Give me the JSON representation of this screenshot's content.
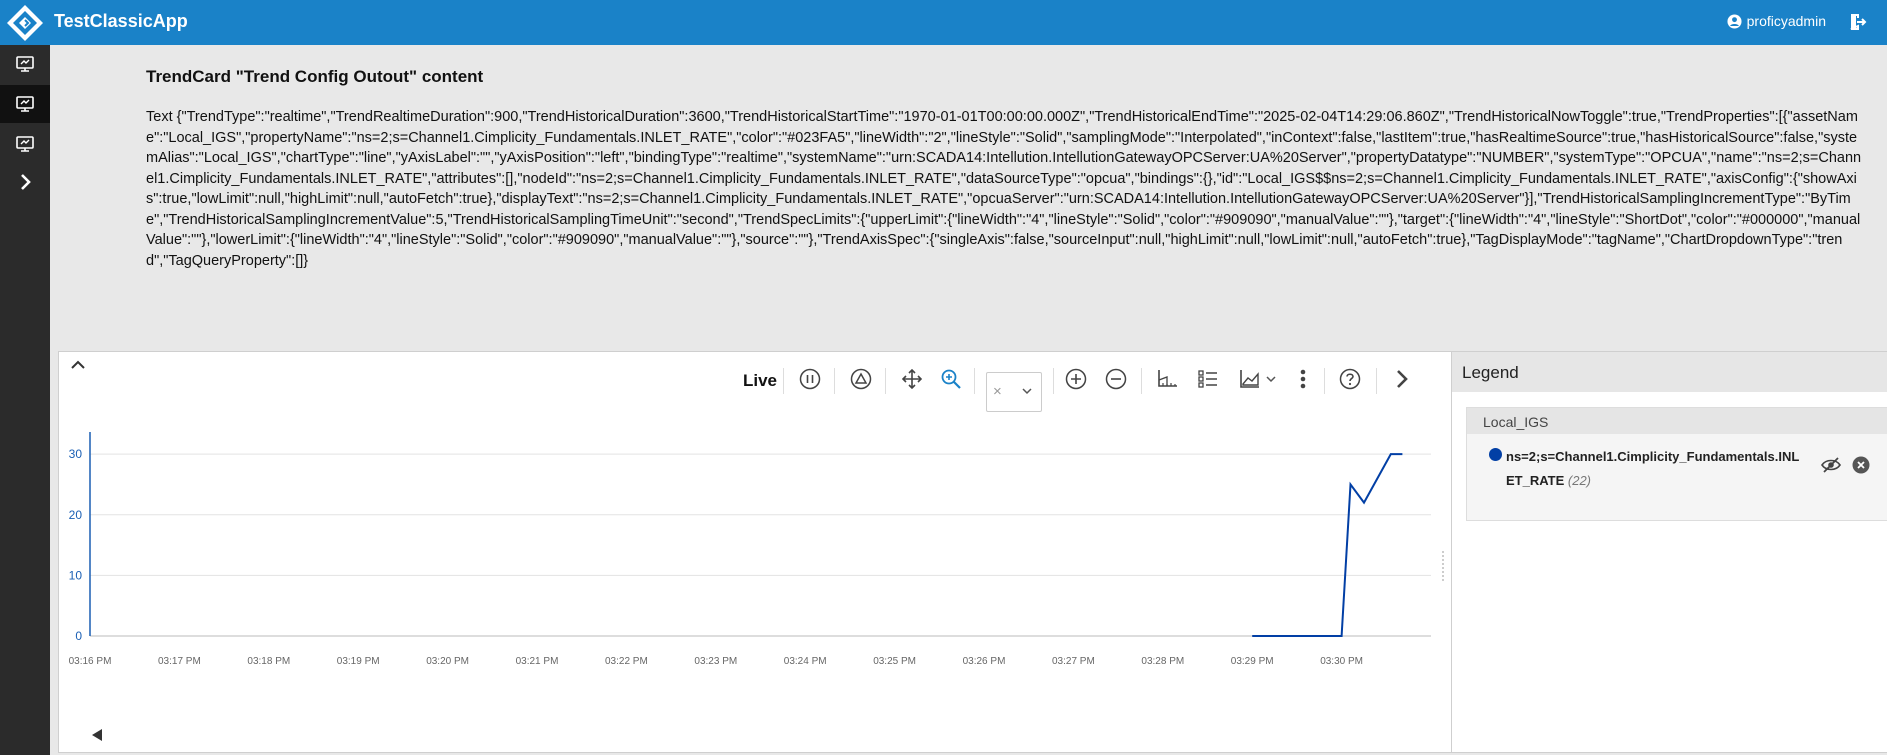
{
  "header": {
    "app_title": "TestClassicApp",
    "username": "proficyadmin"
  },
  "sidebar": {
    "items": [
      {
        "name": "display-1",
        "active": false
      },
      {
        "name": "display-2",
        "active": true
      },
      {
        "name": "display-3",
        "active": false
      },
      {
        "name": "expand",
        "active": false
      }
    ]
  },
  "card": {
    "title": "TrendCard \"Trend Config Outout\" content",
    "text": "Text {\"TrendType\":\"realtime\",\"TrendRealtimeDuration\":900,\"TrendHistoricalDuration\":3600,\"TrendHistoricalStartTime\":\"1970-01-01T00:00:00.000Z\",\"TrendHistoricalEndTime\":\"2025-02-04T14:29:06.860Z\",\"TrendHistoricalNowToggle\":true,\"TrendProperties\":[{\"assetName\":\"Local_IGS\",\"propertyName\":\"ns=2;s=Channel1.Cimplicity_Fundamentals.INLET_RATE\",\"color\":\"#023FA5\",\"lineWidth\":\"2\",\"lineStyle\":\"Solid\",\"samplingMode\":\"Interpolated\",\"inContext\":false,\"lastItem\":true,\"hasRealtimeSource\":true,\"hasHistoricalSource\":false,\"systemAlias\":\"Local_IGS\",\"chartType\":\"line\",\"yAxisLabel\":\"\",\"yAxisPosition\":\"left\",\"bindingType\":\"realtime\",\"systemName\":\"urn:SCADA14:Intellution.IntellutionGatewayOPCServer:UA%20Server\",\"propertyDatatype\":\"NUMBER\",\"systemType\":\"OPCUA\",\"name\":\"ns=2;s=Channel1.Cimplicity_Fundamentals.INLET_RATE\",\"attributes\":[],\"nodeId\":\"ns=2;s=Channel1.Cimplicity_Fundamentals.INLET_RATE\",\"dataSourceType\":\"opcua\",\"bindings\":{},\"id\":\"Local_IGS$$ns=2;s=Channel1.Cimplicity_Fundamentals.INLET_RATE\",\"axisConfig\":{\"showAxis\":true,\"lowLimit\":null,\"highLimit\":null,\"autoFetch\":true},\"displayText\":\"ns=2;s=Channel1.Cimplicity_Fundamentals.INLET_RATE\",\"opcuaServer\":\"urn:SCADA14:Intellution.IntellutionGatewayOPCServer:UA%20Server\"}],\"TrendHistoricalSamplingIncrementType\":\"ByTime\",\"TrendHistoricalSamplingIncrementValue\":5,\"TrendHistoricalSamplingTimeUnit\":\"second\",\"TrendSpecLimits\":{\"upperLimit\":{\"lineWidth\":\"4\",\"lineStyle\":\"Solid\",\"color\":\"#909090\",\"manualValue\":\"\"},\"target\":{\"lineWidth\":\"4\",\"lineStyle\":\"ShortDot\",\"color\":\"#000000\",\"manualValue\":\"\"},\"lowerLimit\":{\"lineWidth\":\"4\",\"lineStyle\":\"Solid\",\"color\":\"#909090\",\"manualValue\":\"\"},\"source\":\"\"},\"TrendAxisSpec\":{\"singleAxis\":false,\"sourceInput\":null,\"highLimit\":null,\"lowLimit\":null,\"autoFetch\":true},\"TagDisplayMode\":\"tagName\",\"ChartDropdownType\":\"trend\",\"TagQueryProperty\":[]}"
  },
  "toolbar": {
    "live_label": "Live",
    "aggregate_value": "×"
  },
  "chart_data": {
    "type": "line",
    "x_ticks": [
      "03:16 PM",
      "03:17 PM",
      "03:18 PM",
      "03:19 PM",
      "03:20 PM",
      "03:21 PM",
      "03:22 PM",
      "03:23 PM",
      "03:24 PM",
      "03:25 PM",
      "03:26 PM",
      "03:27 PM",
      "03:28 PM",
      "03:29 PM",
      "03:30 PM"
    ],
    "y_ticks": [
      0,
      10,
      20,
      30
    ],
    "ylim": [
      0,
      32
    ],
    "xlim_minutes": [
      0,
      15
    ],
    "grid": true,
    "series": [
      {
        "name": "ns=2;s=Channel1.Cimplicity_Fundamentals.INLET_RATE",
        "color": "#023FA5",
        "points": [
          {
            "t": 13.0,
            "v": 0
          },
          {
            "t": 14.0,
            "v": 0
          },
          {
            "t": 14.1,
            "v": 25
          },
          {
            "t": 14.25,
            "v": 22
          },
          {
            "t": 14.55,
            "v": 30
          },
          {
            "t": 14.68,
            "v": 30
          }
        ]
      }
    ]
  },
  "legend": {
    "title": "Legend",
    "group_name": "Local_IGS",
    "item_label": "ns=2;s=Channel1.Cimplicity_Fundamentals.INLET_RATE",
    "item_count": "(22)",
    "item_color": "#023FA5"
  }
}
